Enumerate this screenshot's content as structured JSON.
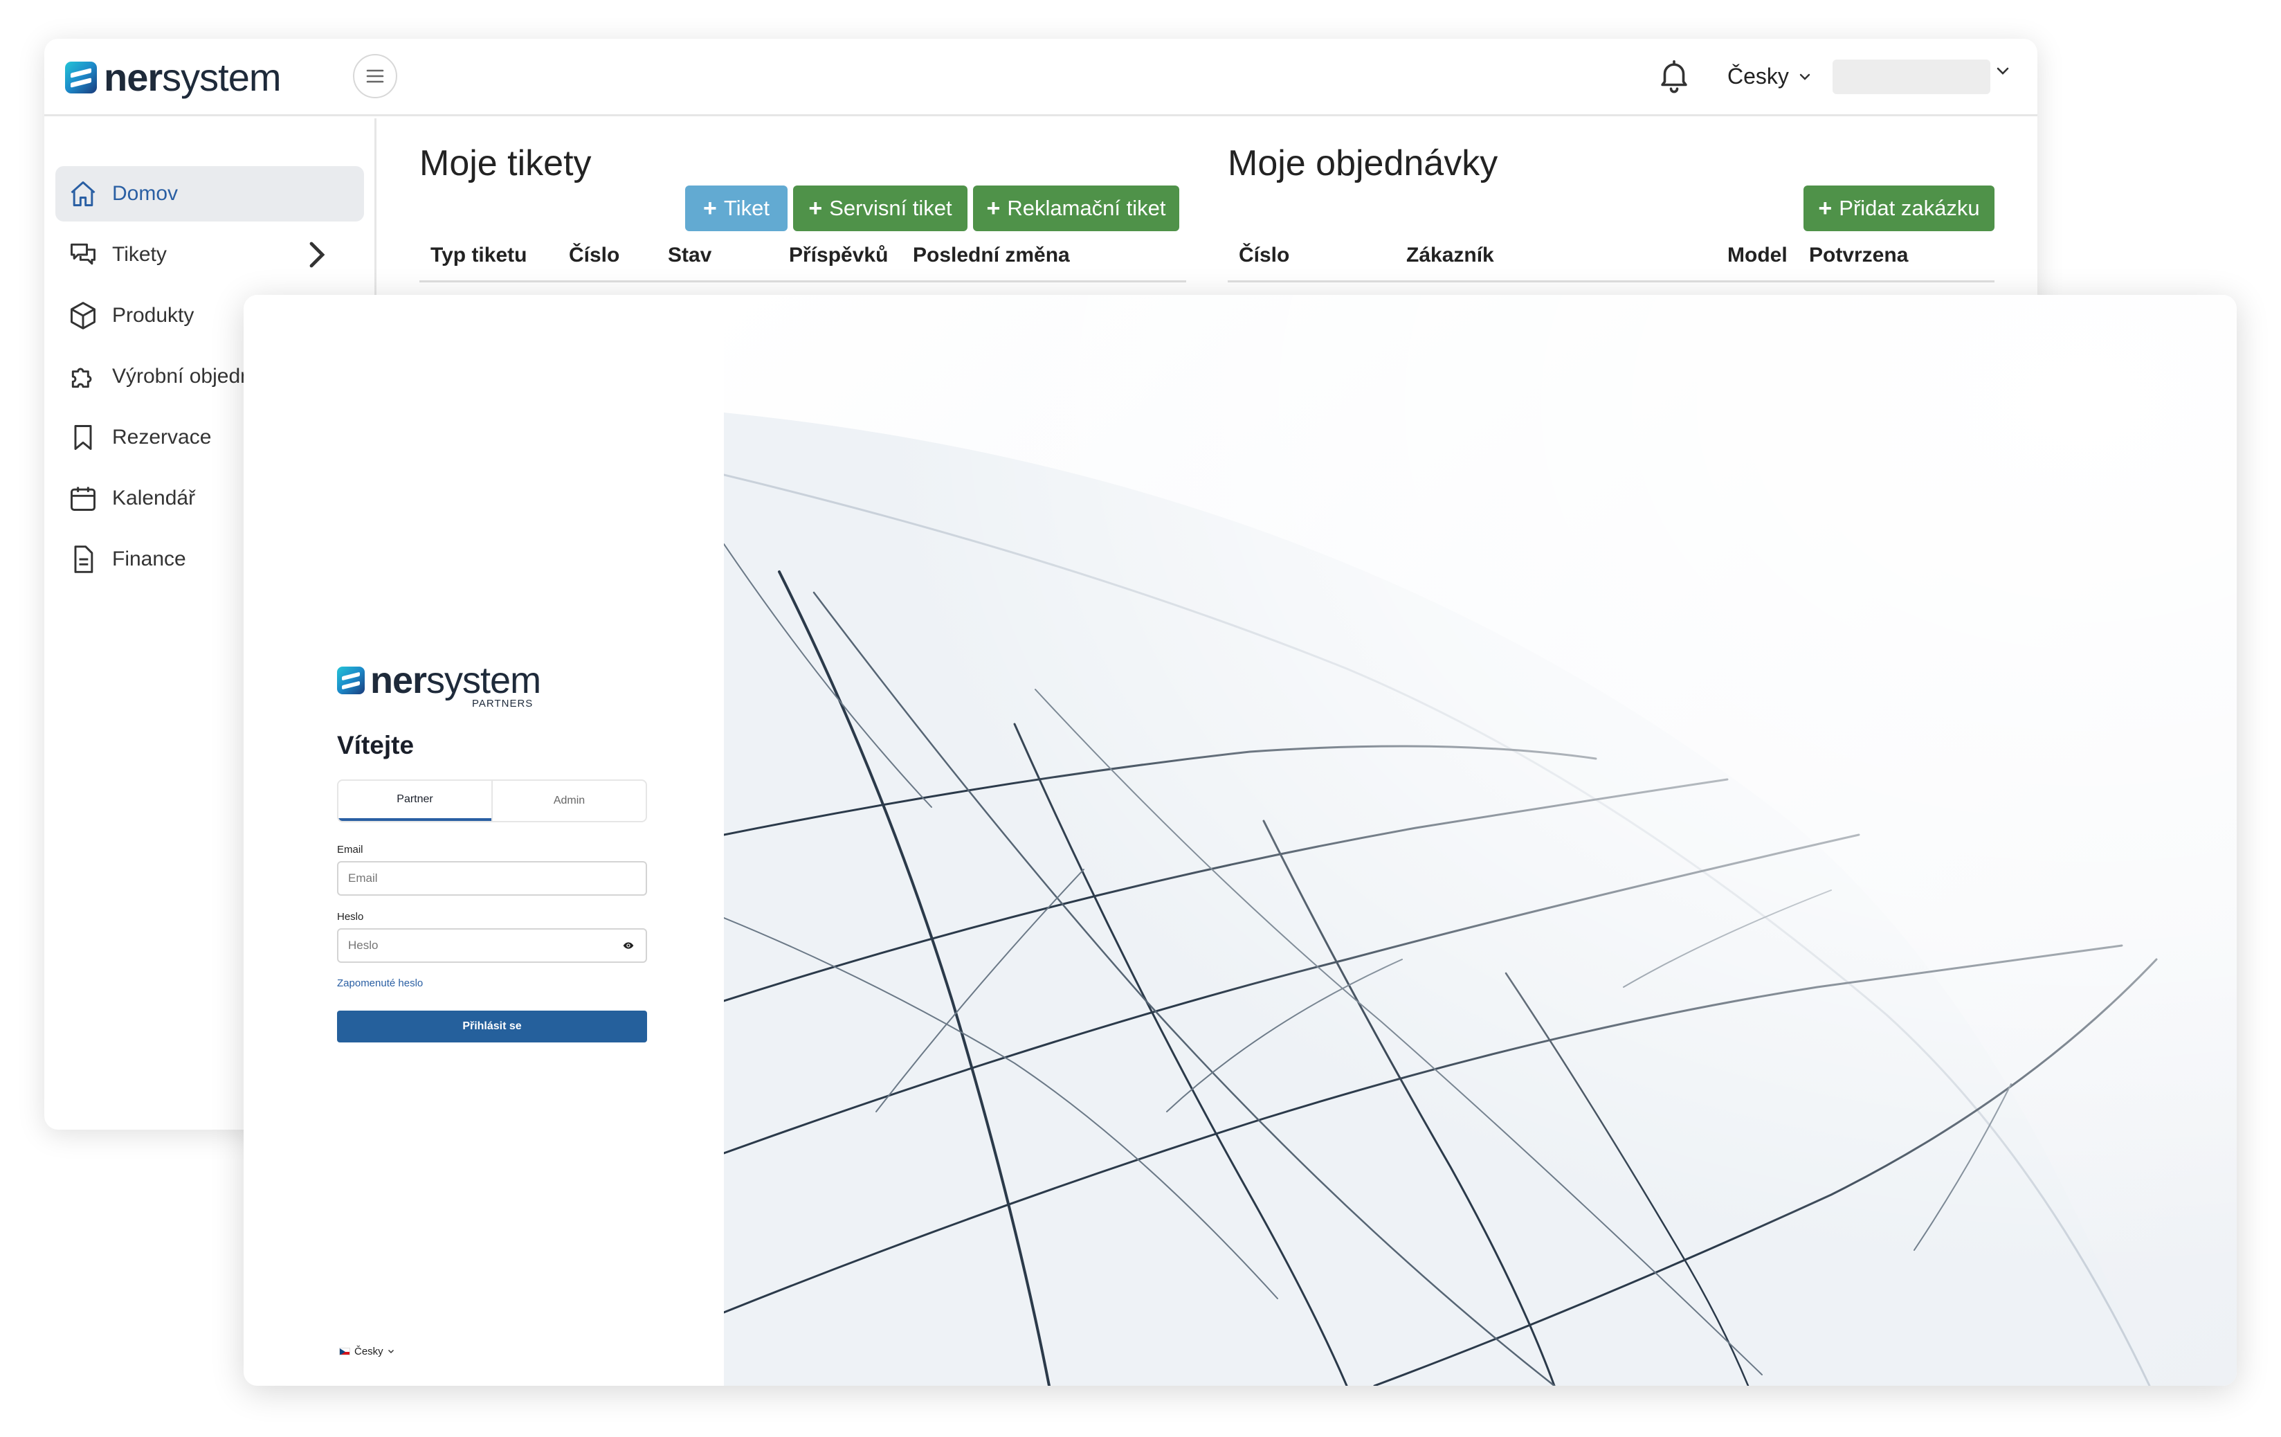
{
  "dashboard": {
    "brand": {
      "bold": "ner",
      "rest": "system",
      "logo_icon": "nersystem-logo-icon"
    },
    "header": {
      "language": "Česky",
      "notifications_icon": "bell-icon",
      "menu_icon": "hamburger-icon"
    },
    "sidebar": {
      "items": [
        {
          "label": "Domov",
          "icon": "home-icon",
          "active": true
        },
        {
          "label": "Tikety",
          "icon": "chat-icon",
          "has_submenu": true
        },
        {
          "label": "Produkty",
          "icon": "cube-icon"
        },
        {
          "label": "Výrobní objedn",
          "icon": "puzzle-icon"
        },
        {
          "label": "Rezervace",
          "icon": "bookmark-icon"
        },
        {
          "label": "Kalendář",
          "icon": "calendar-icon"
        },
        {
          "label": "Finance",
          "icon": "document-icon"
        }
      ]
    },
    "tickets": {
      "title": "Moje tikety",
      "buttons": [
        "Tiket",
        "Servisní tiket",
        "Reklamační tiket"
      ],
      "columns": [
        "Typ tiketu",
        "Číslo",
        "Stav",
        "Příspěvků",
        "Poslední změna"
      ]
    },
    "orders": {
      "title": "Moje objednávky",
      "add_button": "Přidat zakázku",
      "columns": [
        "Číslo",
        "Zákazník",
        "Model",
        "Potvrzena"
      ]
    },
    "colors": {
      "accent_blue": "#62aad2",
      "accent_green": "#4f9249",
      "active_nav": "#2a5fa3"
    }
  },
  "login": {
    "brand": {
      "bold": "ner",
      "rest": "system",
      "sub": "PARTNERS"
    },
    "welcome": "Vítejte",
    "tabs": [
      {
        "label": "Partner",
        "active": true
      },
      {
        "label": "Admin",
        "active": false
      }
    ],
    "email": {
      "label": "Email",
      "placeholder": "Email"
    },
    "password": {
      "label": "Heslo",
      "placeholder": "Heslo",
      "toggle_icon": "eye-icon"
    },
    "forgot": "Zapomenuté heslo",
    "submit": "Přihlásit se",
    "language": "Česky",
    "colors": {
      "primary": "#25609c"
    }
  }
}
